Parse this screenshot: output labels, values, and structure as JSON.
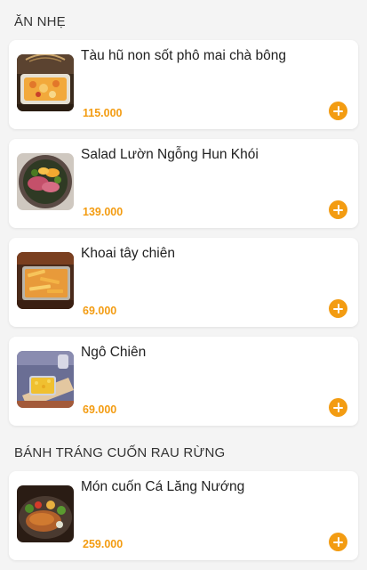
{
  "sections": [
    {
      "title": "ĂN NHẸ",
      "items": [
        {
          "name": "Tàu hũ non sốt phô mai chà bông",
          "price": "115.000",
          "image_icon": "tofu-dish-icon"
        },
        {
          "name": "Salad Lườn Ngỗng Hun Khói",
          "price": "139.000",
          "image_icon": "salad-dish-icon"
        },
        {
          "name": "Khoai tây chiên",
          "price": "69.000",
          "image_icon": "fries-dish-icon"
        },
        {
          "name": "Ngô Chiên",
          "price": "69.000",
          "image_icon": "corn-dish-icon"
        }
      ]
    },
    {
      "title": "BÁNH TRÁNG CUỐN RAU RỪNG",
      "items": [
        {
          "name": "Món cuốn Cá Lăng Nướng",
          "price": "259.000",
          "image_icon": "grilled-fish-dish-icon"
        }
      ]
    }
  ],
  "colors": {
    "accent": "#f39c12",
    "background": "#f4f4f4",
    "card": "#ffffff",
    "text": "#222222"
  }
}
